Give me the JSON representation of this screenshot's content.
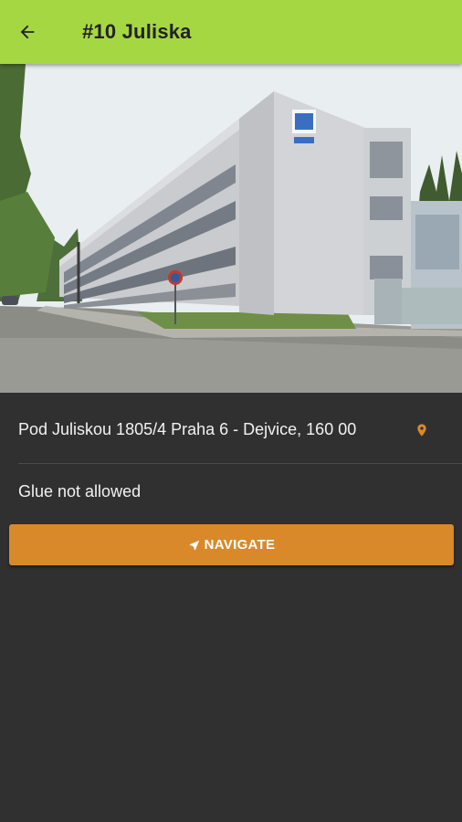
{
  "app_bar": {
    "title": "#10 Juliska",
    "background_color": "#a5d743",
    "back_icon": "arrow-left-icon"
  },
  "photo": {
    "description": "Office building photo"
  },
  "details": {
    "address": "Pod Juliskou 1805/4 Praha 6 - Dejvice, 160 00",
    "address_icon": "map-pin-icon",
    "note": "Glue not allowed"
  },
  "navigate_button": {
    "label": "NAVIGATE",
    "icon": "navigation-arrow-icon",
    "color": "#d9892a"
  },
  "theme": {
    "background": "#303030",
    "accent": "#d9892a"
  }
}
